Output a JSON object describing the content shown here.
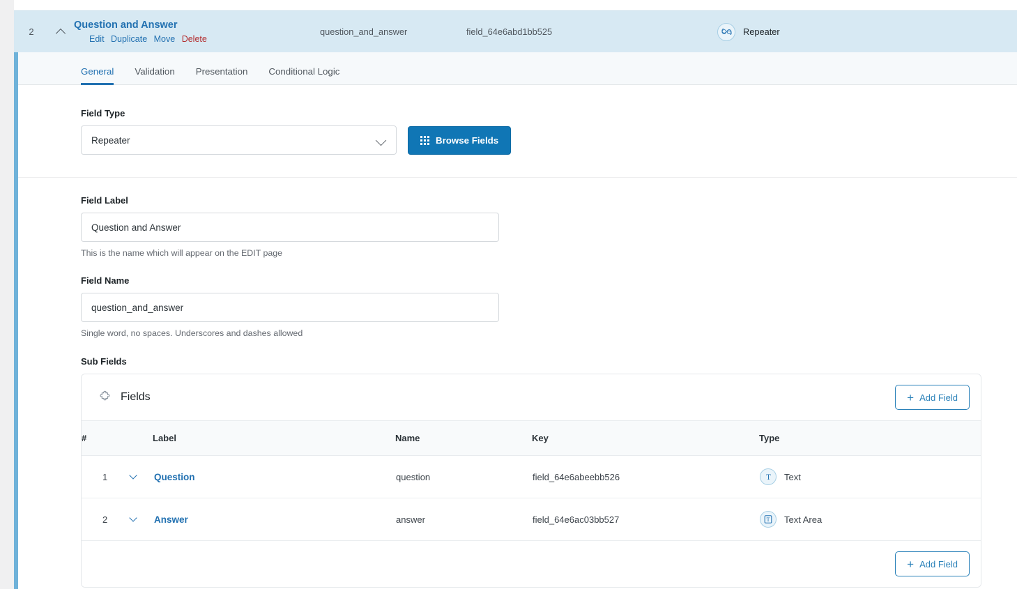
{
  "field": {
    "order": "2",
    "collapse_icon": "chevron-up-icon",
    "title": "Question and Answer",
    "actions": {
      "edit": "Edit",
      "duplicate": "Duplicate",
      "move": "Move",
      "delete": "Delete"
    },
    "name": "question_and_answer",
    "key": "field_64e6abd1bb525",
    "type_label": "Repeater",
    "type_icon": "infinity-icon",
    "accent_color": "#6fb2d9",
    "header_bg": "#d7e9f3"
  },
  "tabs": [
    {
      "label": "General",
      "active": true
    },
    {
      "label": "Validation",
      "active": false
    },
    {
      "label": "Presentation",
      "active": false
    },
    {
      "label": "Conditional Logic",
      "active": false
    }
  ],
  "settings": {
    "field_type": {
      "label": "Field Type",
      "value": "Repeater",
      "browse_button": "Browse Fields",
      "browse_icon": "grid-dots-icon",
      "browse_color": "#1076b5"
    },
    "field_label": {
      "label": "Field Label",
      "value": "Question and Answer",
      "placeholder": "",
      "hint": "This is the name which will appear on the EDIT page"
    },
    "field_name": {
      "label": "Field Name",
      "value": "question_and_answer",
      "placeholder": "",
      "hint": "Single word, no spaces. Underscores and dashes allowed"
    },
    "sub_fields": {
      "label": "Sub Fields",
      "panel_title": "Fields",
      "panel_icon": "puzzle-piece-icon",
      "add_field_top": "Add Field",
      "add_field_bottom": "Add Field",
      "add_icon": "plus-icon",
      "columns": [
        "#",
        "Label",
        "Name",
        "Key",
        "Type"
      ],
      "rows": [
        {
          "order": "1",
          "toggle_icon": "chevron-down-icon",
          "label": "Question",
          "name": "question",
          "key": "field_64e6abeebb526",
          "type": "Text",
          "type_icon": "text-t-icon"
        },
        {
          "order": "2",
          "toggle_icon": "chevron-down-icon",
          "label": "Answer",
          "name": "answer",
          "key": "field_64e6ac03bb527",
          "type": "Text Area",
          "type_icon": "textarea-boxed-t-icon"
        }
      ]
    }
  }
}
